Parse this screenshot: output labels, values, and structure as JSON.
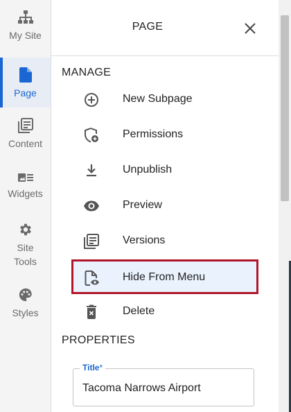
{
  "leftnav": {
    "items": [
      {
        "label": "My Site",
        "icon": "sitemap-icon"
      },
      {
        "label": "Page",
        "icon": "page-icon",
        "active": true
      },
      {
        "label": "Content",
        "icon": "content-library-icon"
      },
      {
        "label": "Widgets",
        "icon": "widgets-icon"
      },
      {
        "label": "Site\nTools",
        "icon": "gear-icon"
      },
      {
        "label": "Styles",
        "icon": "palette-icon"
      }
    ]
  },
  "panel": {
    "title": "PAGE",
    "close_icon": "close-icon",
    "manage_title": "MANAGE",
    "menu": [
      {
        "label": "New Subpage",
        "icon": "plus-circle-icon"
      },
      {
        "label": "Permissions",
        "icon": "shield-plus-icon"
      },
      {
        "label": "Unpublish",
        "icon": "download-icon"
      },
      {
        "label": "Preview",
        "icon": "eye-icon"
      },
      {
        "label": "Versions",
        "icon": "versions-icon"
      },
      {
        "label": "Hide From Menu",
        "icon": "file-eye-icon",
        "highlighted": true
      },
      {
        "label": "Delete",
        "icon": "trash-icon"
      }
    ],
    "properties_title": "PROPERTIES",
    "title_field": {
      "label": "Title",
      "required_mark": "*",
      "value": "Tacoma Narrows Airport"
    }
  },
  "colors": {
    "accent": "#1a66d2",
    "highlight_border": "#b3142a",
    "highlight_bg": "#e9f2fd"
  }
}
